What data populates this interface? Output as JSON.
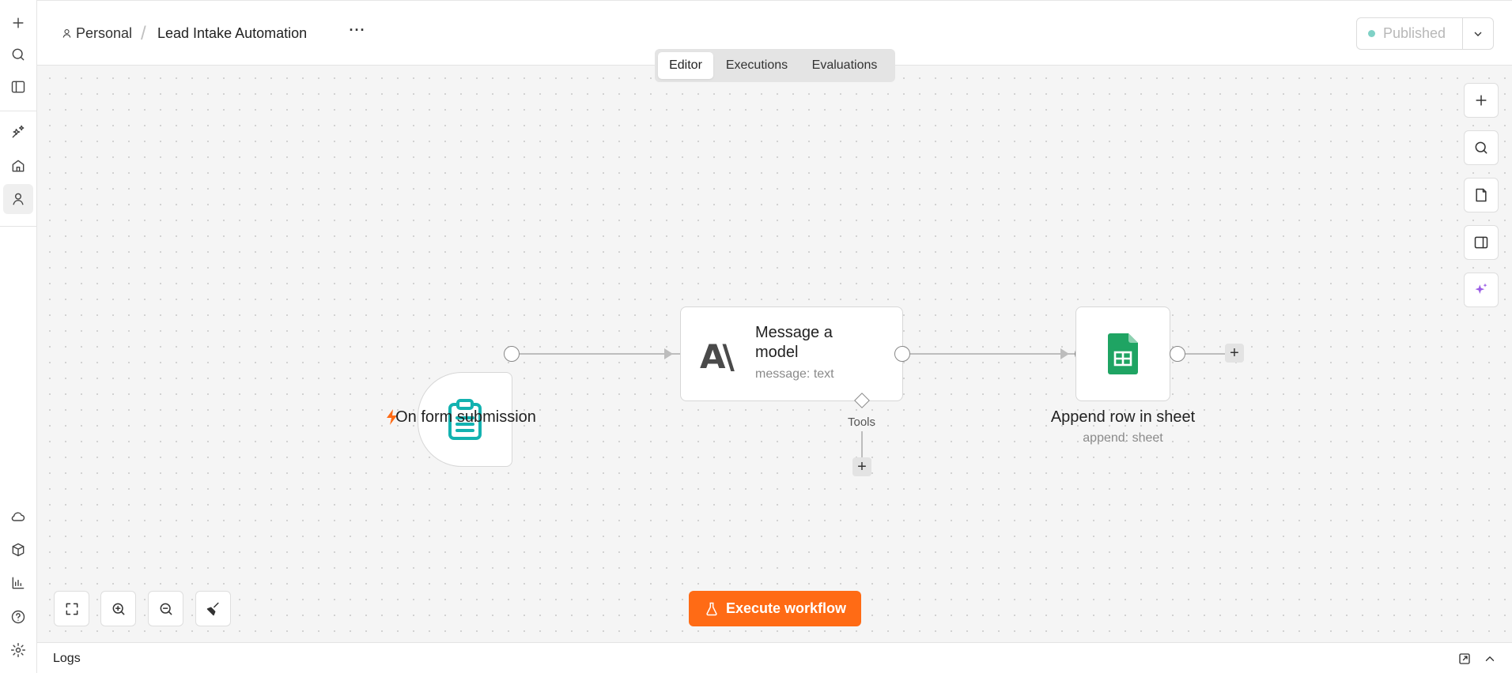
{
  "header": {
    "workspace": "Personal",
    "separator": "/",
    "workflow_title": "Lead Intake Automation",
    "more_label": "···",
    "publish_status": "Published"
  },
  "tabs": [
    {
      "label": "Editor",
      "active": true
    },
    {
      "label": "Executions",
      "active": false
    },
    {
      "label": "Evaluations",
      "active": false
    }
  ],
  "sidebar": {
    "items": [
      {
        "icon": "plus-icon"
      },
      {
        "icon": "search-icon"
      },
      {
        "icon": "panel-toggle-icon"
      },
      {
        "icon": "sparkle-icon"
      },
      {
        "icon": "home-icon"
      },
      {
        "icon": "user-icon",
        "active": true
      },
      {
        "icon": "cloud-icon"
      },
      {
        "icon": "package-icon"
      },
      {
        "icon": "bar-chart-icon"
      },
      {
        "icon": "help-icon"
      },
      {
        "icon": "settings-icon"
      }
    ]
  },
  "nodes": {
    "trigger": {
      "label": "On form submission",
      "icon": "clipboard-icon"
    },
    "ai": {
      "title": "Message a model",
      "subtitle": "message: text",
      "logo": "A\\",
      "tools_label": "Tools"
    },
    "sheet": {
      "label": "Append row in sheet",
      "subtitle": "append: sheet",
      "icon": "google-sheets-icon"
    }
  },
  "canvas_controls": {
    "execute_label": "Execute workflow",
    "add_label": "+"
  },
  "logs": {
    "label": "Logs"
  },
  "colors": {
    "accent": "#ff6b15",
    "trigger_icon": "#13b2b0",
    "sheets_green": "#1fa463",
    "published_dot": "#7fd1c6",
    "ai_sparkle": "#9b5de5",
    "bolt": "#ff6b15"
  }
}
